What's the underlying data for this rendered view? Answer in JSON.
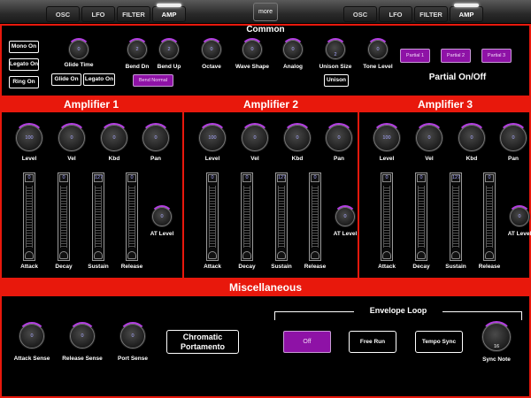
{
  "tabs_left": [
    "OSC",
    "LFO",
    "FILTER",
    "AMP"
  ],
  "tabs_right": [
    "OSC",
    "LFO",
    "FILTER",
    "AMP"
  ],
  "more": "more",
  "common": {
    "title": "Common",
    "mono_on": "Mono On",
    "legato_on": "Legato On",
    "ring_on": "Ring On",
    "glide_time": "Glide Time",
    "glide_on": "Glide On",
    "legato_on2": "Legato On",
    "bend_dn": "Bend Dn",
    "bend_up": "Bend Up",
    "bend_normal": "Bend Normal",
    "octave": "Octave",
    "wave_shape": "Wave Shape",
    "analog": "Analog",
    "unison_size": "Unison Size",
    "unison_size_value": "2",
    "unison": "Unison",
    "tone_level": "Tone Level",
    "partials": [
      "Partial 1",
      "Partial 2",
      "Partial 3"
    ],
    "partial_onoff": "Partial On/Off",
    "knob_values": {
      "glide": "0",
      "bend_dn": "2",
      "bend_up": "2",
      "octave": "0",
      "wave": "0",
      "analog": "0",
      "tone": "0"
    }
  },
  "amplifiers": [
    {
      "title": "Amplifier 1",
      "level": "100",
      "vel": "0",
      "kbd": "0",
      "pan": "0",
      "attack": "0",
      "decay": "0",
      "sustain": "127",
      "release": "0",
      "at_level": "0"
    },
    {
      "title": "Amplifier 2",
      "level": "100",
      "vel": "0",
      "kbd": "0",
      "pan": "0",
      "attack": "0",
      "decay": "0",
      "sustain": "127",
      "release": "0",
      "at_level": "0"
    },
    {
      "title": "Amplifier 3",
      "level": "100",
      "vel": "0",
      "kbd": "0",
      "pan": "0",
      "attack": "0",
      "decay": "0",
      "sustain": "127",
      "release": "0",
      "at_level": "0"
    }
  ],
  "amp_labels": {
    "level": "Level",
    "vel": "Vel",
    "kbd": "Kbd",
    "pan": "Pan",
    "attack": "Attack",
    "decay": "Decay",
    "sustain": "Sustain",
    "release": "Release",
    "at_level": "AT Level"
  },
  "misc": {
    "title": "Miscellaneous",
    "attack_sense": "Attack Sense",
    "release_sense": "Release Sense",
    "port_sense": "Port Sense",
    "attack_sense_value": "0",
    "release_sense_value": "0",
    "port_sense_value": "0",
    "chromatic_line1": "Chromatic",
    "chromatic_line2": "Portamento",
    "envelope_loop": "Envelope Loop",
    "off": "Off",
    "free_run": "Free Run",
    "tempo_sync": "Tempo Sync",
    "sync_note": "Sync Note",
    "sync_note_value": "16"
  },
  "colors": {
    "red": "#e8180c",
    "purple": "#8e12a6",
    "value_text": "#a7a7ff"
  }
}
